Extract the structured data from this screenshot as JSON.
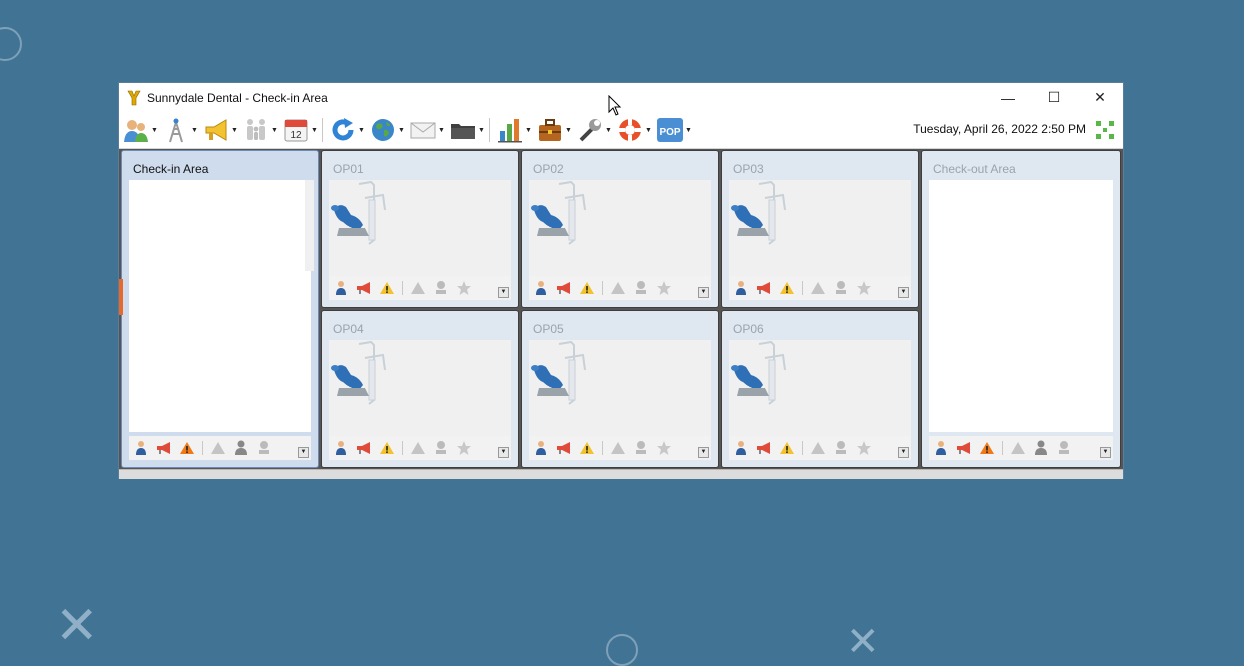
{
  "window": {
    "title": "Sunnydale Dental - Check-in Area",
    "controls": {
      "minimize": "—",
      "maximize": "☐",
      "close": "✕"
    }
  },
  "toolbar": {
    "datetime": "Tuesday, April 26, 2022 2:50 PM",
    "calendar_day": "12",
    "pop_label": "POP",
    "buttons": [
      {
        "icon": "patients-icon",
        "has_dropdown": true
      },
      {
        "icon": "antenna-icon",
        "has_dropdown": true
      },
      {
        "icon": "megaphone-icon",
        "has_dropdown": true
      },
      {
        "icon": "family-icon",
        "has_dropdown": true
      },
      {
        "icon": "calendar-icon",
        "has_dropdown": true
      },
      {
        "icon": "refresh-icon",
        "has_dropdown": true
      },
      {
        "icon": "globe-icon",
        "has_dropdown": true
      },
      {
        "icon": "mail-icon",
        "has_dropdown": true
      },
      {
        "icon": "folder-icon",
        "has_dropdown": true
      },
      {
        "icon": "chart-icon",
        "has_dropdown": true
      },
      {
        "icon": "briefcase-icon",
        "has_dropdown": true
      },
      {
        "icon": "tools-icon",
        "has_dropdown": true
      },
      {
        "icon": "lifebuoy-icon",
        "has_dropdown": true
      },
      {
        "icon": "pop-icon",
        "has_dropdown": true
      }
    ]
  },
  "areas": {
    "checkin": {
      "title": "Check-in Area"
    },
    "checkout": {
      "title": "Check-out Area"
    },
    "ops": [
      {
        "title": "OP01"
      },
      {
        "title": "OP02"
      },
      {
        "title": "OP03"
      },
      {
        "title": "OP04"
      },
      {
        "title": "OP05"
      },
      {
        "title": "OP06"
      }
    ]
  },
  "colors": {
    "desktop": "#417394",
    "accent_blue": "#2f6fb5",
    "warning": "#f0b400",
    "panel_marker": "#e66a2b"
  }
}
